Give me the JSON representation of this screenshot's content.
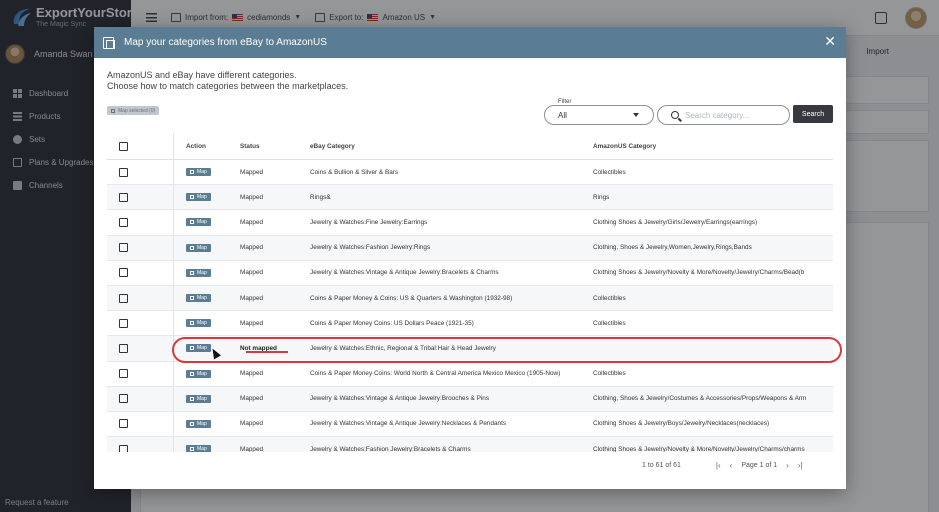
{
  "app": {
    "brand": "ExportYourStore",
    "tagline": "The Magic Sync",
    "user_name": "Amanda Swan",
    "request_feature": "Request a feature"
  },
  "sidebar": {
    "items": [
      {
        "label": "Dashboard",
        "icon": "dashboard-icon"
      },
      {
        "label": "Products",
        "icon": "list-icon"
      },
      {
        "label": "Sets",
        "icon": "sets-icon"
      },
      {
        "label": "Plans & Upgrades",
        "icon": "monitor-icon"
      },
      {
        "label": "Channels",
        "icon": "store-icon"
      }
    ]
  },
  "topbar": {
    "import_from_label": "Import from:",
    "import_from_store": "cediamonds",
    "export_to_label": "Export to:",
    "export_to_store": "Amazon US",
    "import_button": "Import"
  },
  "modal": {
    "title": "Map your categories from eBay to AmazonUS",
    "intro_line1": "AmazonUS and eBay have different categories.",
    "intro_line2": "Choose how to match categories between the marketplaces.",
    "map_selected": "Map selected (0)",
    "filter_label": "Filter",
    "filter_value": "All",
    "search_placeholder": "Search category...",
    "search_button": "Search",
    "columns": {
      "action": "Action",
      "status": "Status",
      "ebay": "eBay Category",
      "amazon": "AmazonUS Category"
    },
    "map_label": "Map",
    "rows": [
      {
        "status": "Mapped",
        "ebay": "Coins & Bullion & Silver & Bars",
        "amazon": "Collectibles"
      },
      {
        "status": "Mapped",
        "ebay": "Rings&",
        "amazon": "Rings"
      },
      {
        "status": "Mapped",
        "ebay": "Jewelry & Watches:Fine Jewelry:Earrings",
        "amazon": "Clothing Shoes & Jewelry/Girls/Jewelry/Earrings(earrings)"
      },
      {
        "status": "Mapped",
        "ebay": "Jewelry & Watches:Fashion Jewelry:Rings",
        "amazon": "Clothing, Shoes & Jewelry,Women,Jewelry,Rings,Bands"
      },
      {
        "status": "Mapped",
        "ebay": "Jewelry & Watches:Vintage & Antique Jewelry:Bracelets & Charms",
        "amazon": "Clothing Shoes & Jewelry/Novelty & More/Novelty/Jewelry/Charms/Bead(b"
      },
      {
        "status": "Mapped",
        "ebay": "Coins & Paper Money & Coins: US & Quarters & Washington (1932-98)",
        "amazon": "Collectibles"
      },
      {
        "status": "Mapped",
        "ebay": "Coins & Paper Money Coins: US Dollars Peace (1921-35)",
        "amazon": "Collectibles"
      },
      {
        "status": "Not mapped",
        "ebay": "Jewelry & Watches:Ethnic, Regional & Tribal:Hair & Head Jewelry",
        "amazon": ""
      },
      {
        "status": "Mapped",
        "ebay": "Coins & Paper Money Coins: World North & Central America Mexico Mexico (1905-Now)",
        "amazon": "Collectibles"
      },
      {
        "status": "Mapped",
        "ebay": "Jewelry & Watches:Vintage & Antique Jewelry:Brooches & Pins",
        "amazon": "Clothing, Shoes & Jewelry/Costumes & Accessories/Props/Weapons & Arm"
      },
      {
        "status": "Mapped",
        "ebay": "Jewelry & Watches:Vintage & Antique Jewelry:Necklaces & Pendants",
        "amazon": "Clothing Shoes & Jewelry/Boys/Jewelry/Necklaces(necklaces)"
      },
      {
        "status": "Mapped",
        "ebay": "Jewelry & Watches:Fashion Jewelry:Bracelets & Charms",
        "amazon": "Clothing Shoes & Jewelry/Novelty & More/Novelty/Jewelry/Charms/charms"
      }
    ],
    "pager": {
      "range": "1 to 61 of 61",
      "page": "Page 1 of 1"
    }
  },
  "colors": {
    "sidebar_bg": "#2b3038",
    "modal_header": "#5b7d93",
    "highlight": "#d63a3a",
    "search_button": "#363a40"
  }
}
